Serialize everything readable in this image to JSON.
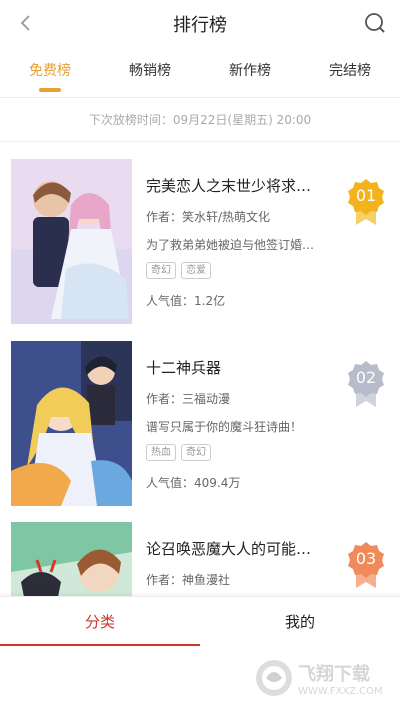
{
  "header": {
    "title": "排行榜",
    "back_icon": "chevron-left-icon",
    "search_icon": "search-icon"
  },
  "tabs": [
    {
      "label": "免费榜",
      "active": true
    },
    {
      "label": "畅销榜",
      "active": false
    },
    {
      "label": "新作榜",
      "active": false
    },
    {
      "label": "完结榜",
      "active": false
    }
  ],
  "schedule": {
    "text": "下次放榜时间：09月22日(星期五) 20:00"
  },
  "items": [
    {
      "rank": "01",
      "rank_color": "#f2b31c",
      "title": "完美恋人之末世少将求…",
      "author": "作者：笑水轩/热萌文化",
      "desc": "为了救弟弟她被迫与他签订婚…",
      "tags": [
        "奇幻",
        "恋爱"
      ],
      "popularity": "人气值：1.2亿"
    },
    {
      "rank": "02",
      "rank_color": "#b7bccb",
      "title": "十二神兵器",
      "author": "作者：三福动漫",
      "desc": "谱写只属于你的魔斗狂诗曲！",
      "tags": [
        "热血",
        "奇幻"
      ],
      "popularity": "人气值：409.4万"
    },
    {
      "rank": "03",
      "rank_color": "#f08a5c",
      "title": "论召唤恶魔大人的可能…",
      "author": "作者：神鱼漫社",
      "desc": "",
      "tags": [],
      "popularity": ""
    }
  ],
  "bottom_nav": [
    {
      "label": "分类",
      "active": true
    },
    {
      "label": "我的",
      "active": false
    }
  ],
  "watermark": {
    "text": "飞翔下载",
    "url": "WWW.FXXZ.COM"
  },
  "colors": {
    "accent": "#e8a033",
    "nav_active": "#c53a2a",
    "gold": "#f2b31c",
    "silver": "#b7bccb",
    "bronze": "#f08a5c"
  }
}
